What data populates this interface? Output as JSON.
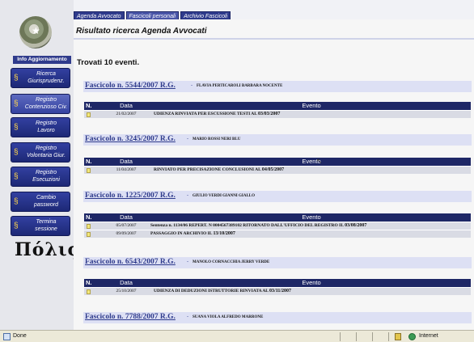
{
  "top_nav": [
    {
      "label": "Agenda Avvocato",
      "active": false
    },
    {
      "label": "Fascicoli personali",
      "active": true
    },
    {
      "label": "Archivio Fascicoli",
      "active": false
    }
  ],
  "sidebar": {
    "emblem_icon": "republic-emblem-icon",
    "info_label": "Info Aggiornamento",
    "items": [
      {
        "label": "Ricerca\nGiurisprudenz.",
        "active": false
      },
      {
        "label": "Registro\nContenzioso Civ.",
        "active": true
      },
      {
        "label": "Registro\nLavoro",
        "active": false
      },
      {
        "label": "Registro\nVolontaria Giur.",
        "active": false
      },
      {
        "label": "Registro\nEsecuzioni",
        "active": false
      },
      {
        "label": "Cambio\npassword",
        "active": false
      },
      {
        "label": "Termina\nsessione",
        "active": false
      }
    ],
    "logo_text": "Πόλις"
  },
  "main": {
    "title": "Risultato ricerca Agenda Avvocati",
    "found_text": "Trovati 10 eventi."
  },
  "table_headers": {
    "n": "N.",
    "date": "Data",
    "event": "Evento"
  },
  "fascicoli": [
    {
      "link": "Fascicolo n. 5544/2007 R.G.",
      "separator": "-",
      "names": "FLAVIA PERTICAROLI BARBARA NOCENTE",
      "events": [
        {
          "date": "21/02/2007",
          "text": "UDIENZA RINVIATA PER ESCUSSIONE TESTI AL",
          "bold": "03/03/2007"
        }
      ]
    },
    {
      "link": "Fascicolo n. 3245/2007 R.G.",
      "separator": "-",
      "names": "MARIO ROSSI NERI BLU",
      "events": [
        {
          "date": "11/04/2007",
          "text": "RINVIATO PER PRECISAZIONE CONCLUSIONI AL",
          "bold": "04/05/2007"
        }
      ]
    },
    {
      "link": "Fascicolo n. 1225/2007 R.G.",
      "separator": "-",
      "names": "GIULIO VERDI GIANNI GIALLO",
      "events": [
        {
          "date": "05/07/2007",
          "text": "Sentenza n. 1134/06 REPERT. N 0004567389102 RITORNATO DALL'UFFICIO DEL REGISTRO IL",
          "bold": "03/08/2007"
        },
        {
          "date": "09/09/2007",
          "text": "PASSAGGIO IN ARCHIVIO IL",
          "bold": "13/10/2007"
        }
      ]
    },
    {
      "link": "Fascicolo n. 6543/2007 R.G.",
      "separator": "-",
      "names": "MANOLO CORNACCHIA JERRY VERDE",
      "events": [
        {
          "date": "25/10/2007",
          "text": "UDIENZA DI DEDUZIONI ISTRUTTORIE RINVIATA AL",
          "bold": "03/11/2007"
        }
      ]
    },
    {
      "link": "Fascicolo n. 7788/2007 R.G.",
      "separator": "-",
      "names": "SUANA VIOLA ALFREDO MARRONE",
      "events": []
    }
  ],
  "status_bar": {
    "status": "Done",
    "zone": "Internet"
  },
  "colors": {
    "nav_blue": "#2f3b8c",
    "header_dark": "#1e2766",
    "fascicolo_band": "#dde0f4"
  }
}
